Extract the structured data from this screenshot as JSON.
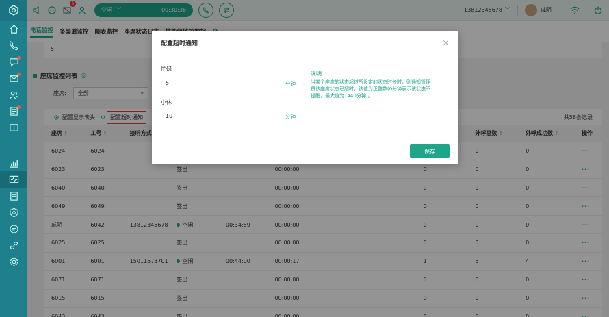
{
  "sidebar": {
    "items": [
      {
        "icon": "home-icon",
        "dot": false
      },
      {
        "icon": "phone-icon",
        "dot": false
      },
      {
        "icon": "chat-icon",
        "dot": true
      },
      {
        "icon": "mail-icon",
        "dot": true
      },
      {
        "icon": "contacts-icon",
        "dot": false
      },
      {
        "icon": "list-icon",
        "dot": true
      },
      {
        "icon": "book-icon",
        "dot": false
      },
      {
        "icon": "chart-icon",
        "dot": false
      },
      {
        "icon": "monitor-icon",
        "dot": false,
        "active": true
      },
      {
        "icon": "report-icon",
        "dot": false
      },
      {
        "icon": "shield-icon",
        "dot": false
      },
      {
        "icon": "message-icon",
        "dot": false
      },
      {
        "icon": "link-icon",
        "dot": false
      },
      {
        "icon": "gear-icon",
        "dot": false
      }
    ]
  },
  "topbar": {
    "notification_count": "5",
    "status": "空闲",
    "timer": "00:30:36",
    "phone": "13812345678",
    "user": "戚陌"
  },
  "tabs": [
    "电话监控",
    "多渠道监控",
    "图表监控",
    "座席状态日志",
    "技能组监控数据"
  ],
  "background": {
    "strip_value": "5",
    "section_title": "座席监控列表",
    "filter_label": "座席:",
    "filter_value": "全部",
    "toolbar_config_header": "配置显示表头",
    "toolbar_config_timeout": "配置超时通知",
    "total": "共58条记录",
    "columns": [
      "座席",
      "工号",
      "接听方式",
      "",
      "",
      "",
      "",
      "",
      "外呼总数",
      "外呼成功数",
      "操作"
    ],
    "rows": [
      [
        "6024",
        "6024",
        "",
        "",
        "",
        "",
        "",
        "0",
        "0",
        "0",
        "···"
      ],
      [
        "6023",
        "6023",
        "",
        "签出",
        "",
        "00:00:00",
        "",
        "0",
        "0",
        "0",
        "···"
      ],
      [
        "6040",
        "6040",
        "",
        "签出",
        "",
        "00:00:00",
        "",
        "0",
        "0",
        "0",
        "···"
      ],
      [
        "6049",
        "6049",
        "",
        "签出",
        "",
        "00:00:00",
        "",
        "0",
        "0",
        "0",
        "···"
      ],
      [
        "戚陌",
        "6042",
        "13812345678",
        "空闲",
        "00:34:59",
        "00:00:00",
        "",
        "0",
        "0",
        "0",
        "···"
      ],
      [
        "6025",
        "6025",
        "",
        "签出",
        "",
        "00:00:00",
        "",
        "0",
        "0",
        "0",
        "···"
      ],
      [
        "6001",
        "6001",
        "15011573701",
        "空闲",
        "00:44:00",
        "00:00:17",
        "",
        "1",
        "5",
        "4",
        "···"
      ],
      [
        "6071",
        "6071",
        "",
        "签出",
        "",
        "00:00:00",
        "",
        "0",
        "0",
        "0",
        "···"
      ],
      [
        "6015",
        "6015",
        "",
        "签出",
        "",
        "00:00:00",
        "",
        "0",
        "0",
        "0",
        "···"
      ],
      [
        "6043",
        "6043",
        "",
        "签出",
        "",
        "00:00:00",
        "",
        "0",
        "0",
        "0",
        "···"
      ]
    ]
  },
  "modal": {
    "title": "配置超时通知",
    "busy_label": "忙碌",
    "busy_value": "5",
    "rest_label": "小休",
    "rest_value": "10",
    "unit": "分钟",
    "explain_title": "说明:",
    "explain_text": "当某个座席的状态超过所设定的状态时长时，则通知管理员该座席状态已超时，该值为正整数(0分钟表示该状态不提醒，最大值为1440分钟)。",
    "save_label": "保存"
  },
  "colors": {
    "accent": "#1ea58a",
    "sidebar": "#1e7f8d",
    "highlight_box": "#e53935"
  }
}
